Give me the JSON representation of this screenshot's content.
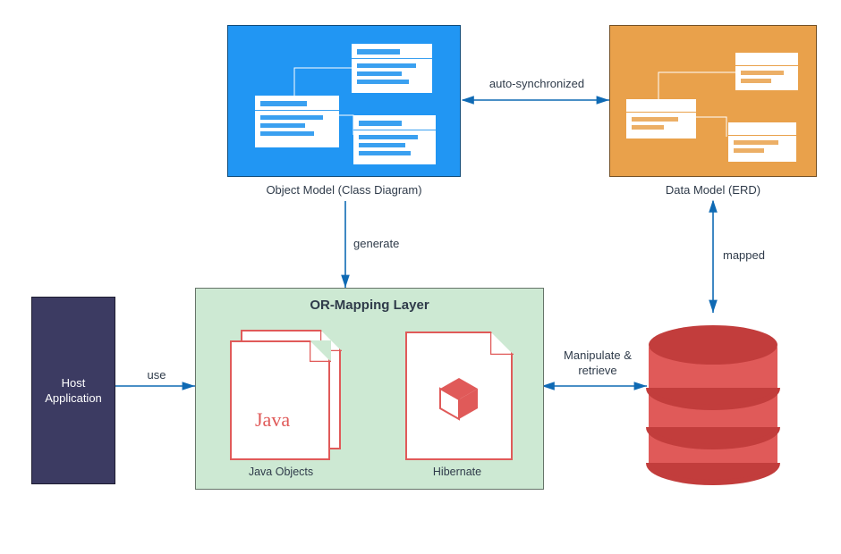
{
  "nodes": {
    "object_model": {
      "label": "Object Model (Class Diagram)"
    },
    "data_model": {
      "label": "Data Model (ERD)"
    },
    "host_app": {
      "label": "Host\nApplication"
    },
    "orm_layer": {
      "title": "OR-Mapping Layer",
      "java": {
        "label": "Java Objects",
        "text": "Java"
      },
      "hibernate": {
        "label": "Hibernate"
      }
    }
  },
  "edges": {
    "auto_sync": "auto-synchronized",
    "generate": "generate",
    "mapped": "mapped",
    "use": "use",
    "manipulate": "Manipulate &\nretrieve"
  }
}
